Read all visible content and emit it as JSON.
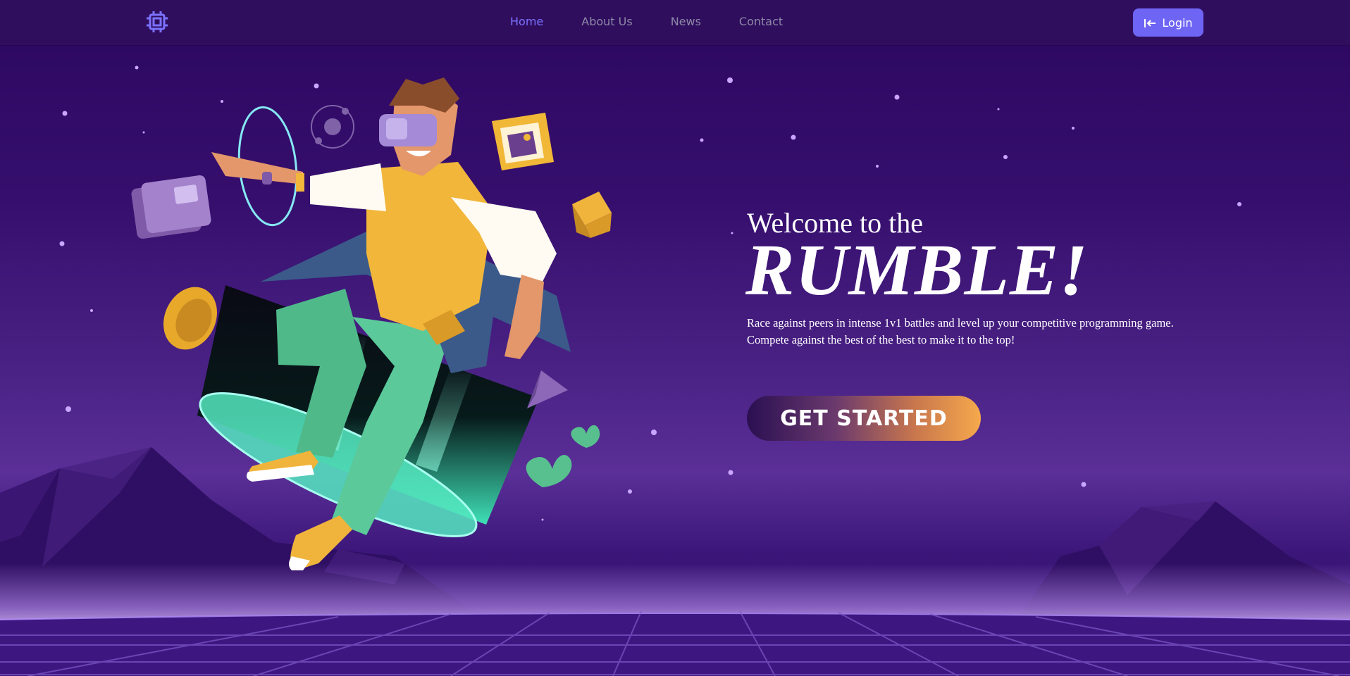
{
  "nav": {
    "logo_icon": "chip-icon",
    "links": [
      {
        "label": "Home",
        "active": true
      },
      {
        "label": "About Us",
        "active": false
      },
      {
        "label": "News",
        "active": false
      },
      {
        "label": "Contact",
        "active": false
      }
    ],
    "login_label": "Login",
    "login_icon": "login-arrow-icon"
  },
  "hero": {
    "welcome": "Welcome to the",
    "title": "RUMBLE!",
    "description": "Race against peers in intense 1v1 battles and level up your competitive programming game. Compete against the best of the best to make it to the top!",
    "cta_label": "GET STARTED"
  },
  "colors": {
    "nav_background": "#2f0e5e",
    "nav_active": "#7b72ff",
    "nav_inactive": "#8e88a6",
    "login_button": "#6f65f4",
    "cta_gradient_start": "#2a0f52",
    "cta_gradient_end": "#f6a94c"
  }
}
